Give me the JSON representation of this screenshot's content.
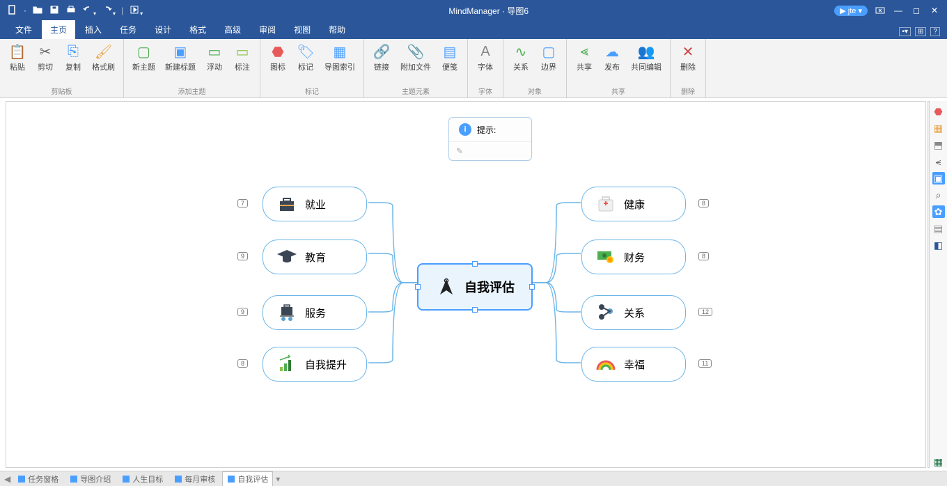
{
  "titlebar": {
    "app_title": "MindManager · 导图6",
    "user_label": "jte ▾"
  },
  "menu": {
    "tabs": [
      "文件",
      "主页",
      "插入",
      "任务",
      "设计",
      "格式",
      "高级",
      "审阅",
      "视图",
      "帮助"
    ],
    "active_index": 1
  },
  "ribbon": {
    "groups": [
      {
        "label": "剪贴板",
        "items": [
          {
            "label": "粘贴",
            "icon": "paste",
            "color": "#4a9eff"
          },
          {
            "label": "剪切",
            "icon": "cut",
            "color": "#666"
          },
          {
            "label": "复制",
            "icon": "copy",
            "color": "#4a9eff"
          },
          {
            "label": "格式刷",
            "icon": "brush",
            "color": "#e8a54a"
          }
        ]
      },
      {
        "label": "添加主题",
        "items": [
          {
            "label": "新主题",
            "icon": "new-topic",
            "color": "#4caf50"
          },
          {
            "label": "新建标题",
            "icon": "new-title",
            "color": "#4a9eff"
          },
          {
            "label": "浮动",
            "icon": "float",
            "color": "#4caf50"
          },
          {
            "label": "标注",
            "icon": "callout",
            "color": "#8bc34a"
          }
        ]
      },
      {
        "label": "标记",
        "items": [
          {
            "label": "图标",
            "icon": "tag-icon",
            "color": "#e85a5a"
          },
          {
            "label": "标记",
            "icon": "tag",
            "color": "#4a9eff"
          },
          {
            "label": "导图索引",
            "icon": "map-index",
            "color": "#4a9eff"
          }
        ]
      },
      {
        "label": "主题元素",
        "items": [
          {
            "label": "链接",
            "icon": "link",
            "color": "#4a9eff"
          },
          {
            "label": "附加文件",
            "icon": "attach",
            "color": "#888"
          },
          {
            "label": "便笺",
            "icon": "note",
            "color": "#4a9eff"
          }
        ]
      },
      {
        "label": "字体",
        "items": [
          {
            "label": "字体",
            "icon": "font",
            "color": "#888"
          }
        ]
      },
      {
        "label": "对象",
        "items": [
          {
            "label": "关系",
            "icon": "relation",
            "color": "#4caf50"
          },
          {
            "label": "边界",
            "icon": "boundary",
            "color": "#4a9eff"
          }
        ]
      },
      {
        "label": "共享",
        "items": [
          {
            "label": "共享",
            "icon": "share",
            "color": "#4caf50"
          },
          {
            "label": "发布",
            "icon": "publish",
            "color": "#4a9eff"
          },
          {
            "label": "共同编辑",
            "icon": "coedit",
            "color": "#888"
          }
        ]
      },
      {
        "label": "删除",
        "items": [
          {
            "label": "删除",
            "icon": "delete",
            "color": "#d04545"
          }
        ]
      }
    ]
  },
  "mindmap": {
    "center": "自我评估",
    "tip_label": "提示:",
    "left_nodes": [
      {
        "label": "就业",
        "icon": "briefcase",
        "count": "7"
      },
      {
        "label": "教育",
        "icon": "grad-cap",
        "count": "9"
      },
      {
        "label": "服务",
        "icon": "trolley",
        "count": "9"
      },
      {
        "label": "自我提升",
        "icon": "growth",
        "count": "8"
      }
    ],
    "right_nodes": [
      {
        "label": "健康",
        "icon": "medkit",
        "count": "8"
      },
      {
        "label": "财务",
        "icon": "money",
        "count": "8"
      },
      {
        "label": "关系",
        "icon": "nodes",
        "count": "12"
      },
      {
        "label": "幸福",
        "icon": "rainbow",
        "count": "11"
      }
    ]
  },
  "bottom_tabs": [
    "任务窗格",
    "导图介绍",
    "人生目标",
    "每月审核",
    "自我评估"
  ],
  "bottom_active": 4
}
